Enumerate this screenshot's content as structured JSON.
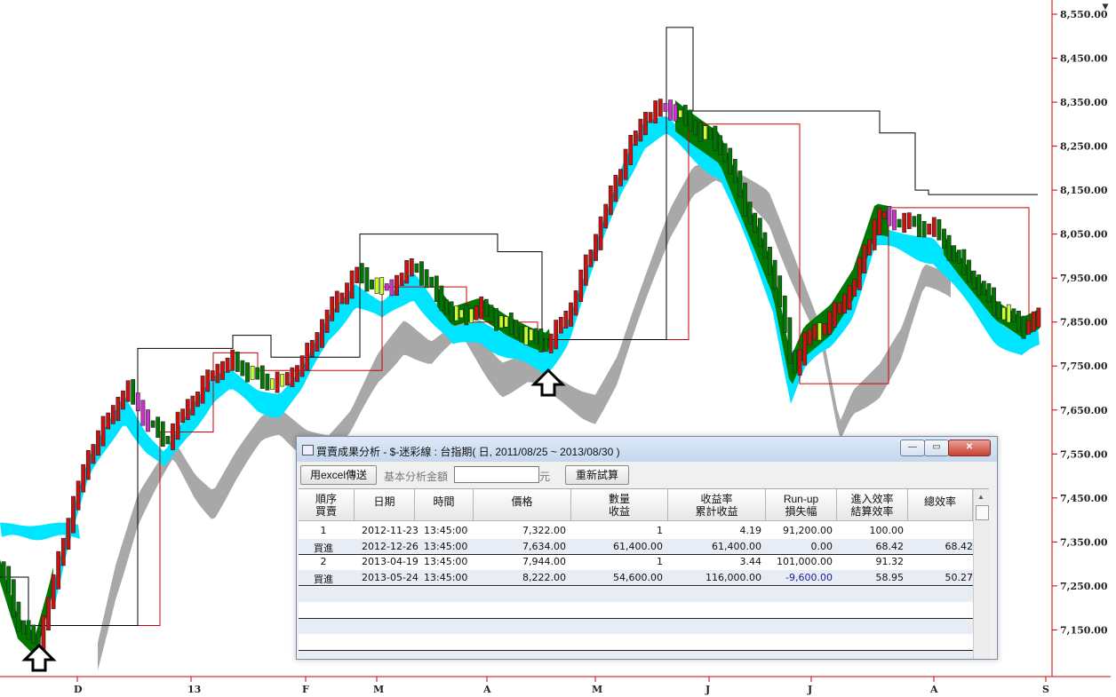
{
  "chart": {
    "price_labels": [
      "8,550.00",
      "8,450.00",
      "8,350.00",
      "8,250.00",
      "8,150.00",
      "8,050.00",
      "7,950.00",
      "7,850.00",
      "7,750.00",
      "7,650.00",
      "7,550.00",
      "7,450.00",
      "7,350.00",
      "7,250.00",
      "7,150.00"
    ],
    "date_labels": [
      "D",
      "13",
      "F",
      "M",
      "A",
      "M",
      "J",
      "J",
      "A",
      "S"
    ],
    "colors": {
      "red_candle": "#cc1111",
      "green_candle": "#007700",
      "yellow_candle": "#ccff33",
      "purple_candle": "#cc33cc",
      "cyan_band": "#00e5ff",
      "gray_band": "#a8a8a8",
      "green_band": "#007700",
      "stop_red": "#cc0000",
      "stop_black": "#000000",
      "axis_red": "#cc0000"
    }
  },
  "dialog": {
    "title": "買賣成果分析 - $-迷彩線 : 台指期( 日, 2011/08/25 ~ 2013/08/30 )",
    "buttons": {
      "minimize": "—",
      "maximize": "▭",
      "close": "✕"
    },
    "toolbar": {
      "excel_button": "用excel傳送",
      "amount_label": "基本分析金額",
      "amount_value": "",
      "unit": "元",
      "recalc_button": "重新試算"
    },
    "columns": [
      {
        "l1": "順序",
        "l2": "買賣"
      },
      {
        "l1": "日期",
        "l2": ""
      },
      {
        "l1": "時間",
        "l2": ""
      },
      {
        "l1": "價格",
        "l2": ""
      },
      {
        "l1": "數量",
        "l2": "收益"
      },
      {
        "l1": "收益率",
        "l2": "累計收益"
      },
      {
        "l1": "Run-up",
        "l2": "損失幅"
      },
      {
        "l1": "進入效率",
        "l2": "結算效率"
      },
      {
        "l1": "總效率",
        "l2": ""
      }
    ],
    "rows": [
      [
        "1",
        "2012-11-23",
        "13:45:00",
        "7,322.00",
        "1",
        "4.19",
        "91,200.00",
        "100.00",
        ""
      ],
      [
        "買進",
        "2012-12-26",
        "13:45:00",
        "7,634.00",
        "61,400.00",
        "61,400.00",
        "0.00",
        "68.42",
        "68.42"
      ],
      [
        "2",
        "2013-04-19",
        "13:45:00",
        "7,944.00",
        "1",
        "3.44",
        "101,000.00",
        "91.32",
        ""
      ],
      [
        "買進",
        "2013-05-24",
        "13:45:00",
        "8,222.00",
        "54,600.00",
        "116,000.00",
        "-9,600.00",
        "58.95",
        "50.27"
      ]
    ]
  }
}
